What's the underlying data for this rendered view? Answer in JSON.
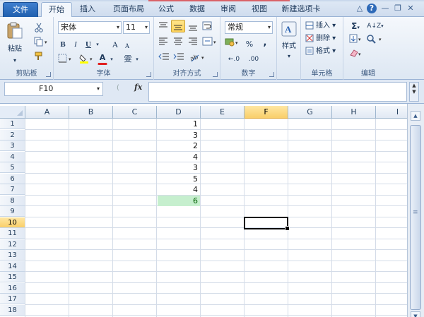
{
  "ribbon_tabs": {
    "file": "文件",
    "items": [
      "开始",
      "插入",
      "页面布局",
      "公式",
      "数据",
      "审阅",
      "视图",
      "新建选项卡"
    ],
    "active_index": 0
  },
  "window_controls": {
    "minimize_ribbon": "△",
    "help": "?",
    "minimize": "—",
    "restore": "❐",
    "close": "✕"
  },
  "clipboard": {
    "paste": "粘贴",
    "label": "剪贴板"
  },
  "font": {
    "name": "宋体",
    "size": "11",
    "bold": "B",
    "italic": "I",
    "underline": "U",
    "grow": "A",
    "shrink": "A",
    "font_color": "A",
    "phonetic": "雯",
    "label": "字体"
  },
  "alignment": {
    "label": "对齐方式"
  },
  "number": {
    "format": "常规",
    "percent": "%",
    "comma": ",",
    "inc_decimal": "←.0",
    "dec_decimal": ".00",
    "label": "数字"
  },
  "styles": {
    "label": "样式"
  },
  "cells": {
    "insert": "插入",
    "delete": "删除",
    "format": "格式",
    "label": "单元格"
  },
  "editing": {
    "sum": "Σ",
    "sort": "A↓Z",
    "find": "A",
    "clear": "◇",
    "label": "编辑"
  },
  "formula_bar": {
    "name_box": "F10",
    "fx": "fx",
    "formula": ""
  },
  "sheet": {
    "columns": [
      "A",
      "B",
      "C",
      "D",
      "E",
      "F",
      "G",
      "H",
      "I"
    ],
    "selected_column": "F",
    "rows": [
      "1",
      "2",
      "3",
      "4",
      "5",
      "6",
      "7",
      "8",
      "9",
      "10",
      "11",
      "12",
      "13",
      "14",
      "15",
      "16",
      "17",
      "18"
    ],
    "selected_row": "10",
    "column_d_values": [
      "1",
      "3",
      "2",
      "4",
      "3",
      "5",
      "4",
      "6"
    ],
    "highlighted_cell": "D8",
    "active_cell": "F10"
  },
  "colors": {
    "accent": "#1f5fae",
    "highlight_fill": "#c6efce",
    "highlight_text": "#006100"
  }
}
